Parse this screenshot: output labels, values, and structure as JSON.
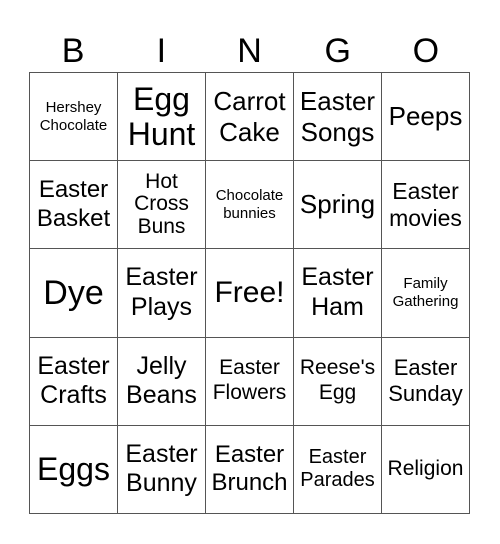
{
  "header": [
    "B",
    "I",
    "N",
    "G",
    "O"
  ],
  "cells": [
    "Hershey Chocolate",
    "Egg Hunt",
    "Carrot Cake",
    "Easter Songs",
    "Peeps",
    "Easter Basket",
    "Hot Cross Buns",
    "Chocolate bunnies",
    "Spring",
    "Easter movies",
    "Dye",
    "Easter Plays",
    "Free!",
    "Easter Ham",
    "Family Gathering",
    "Easter Crafts",
    "Jelly Beans",
    "Easter Flowers",
    "Reese's Egg",
    "Easter Sunday",
    "Eggs",
    "Easter Bunny",
    "Easter Brunch",
    "Easter Parades",
    "Religion"
  ]
}
